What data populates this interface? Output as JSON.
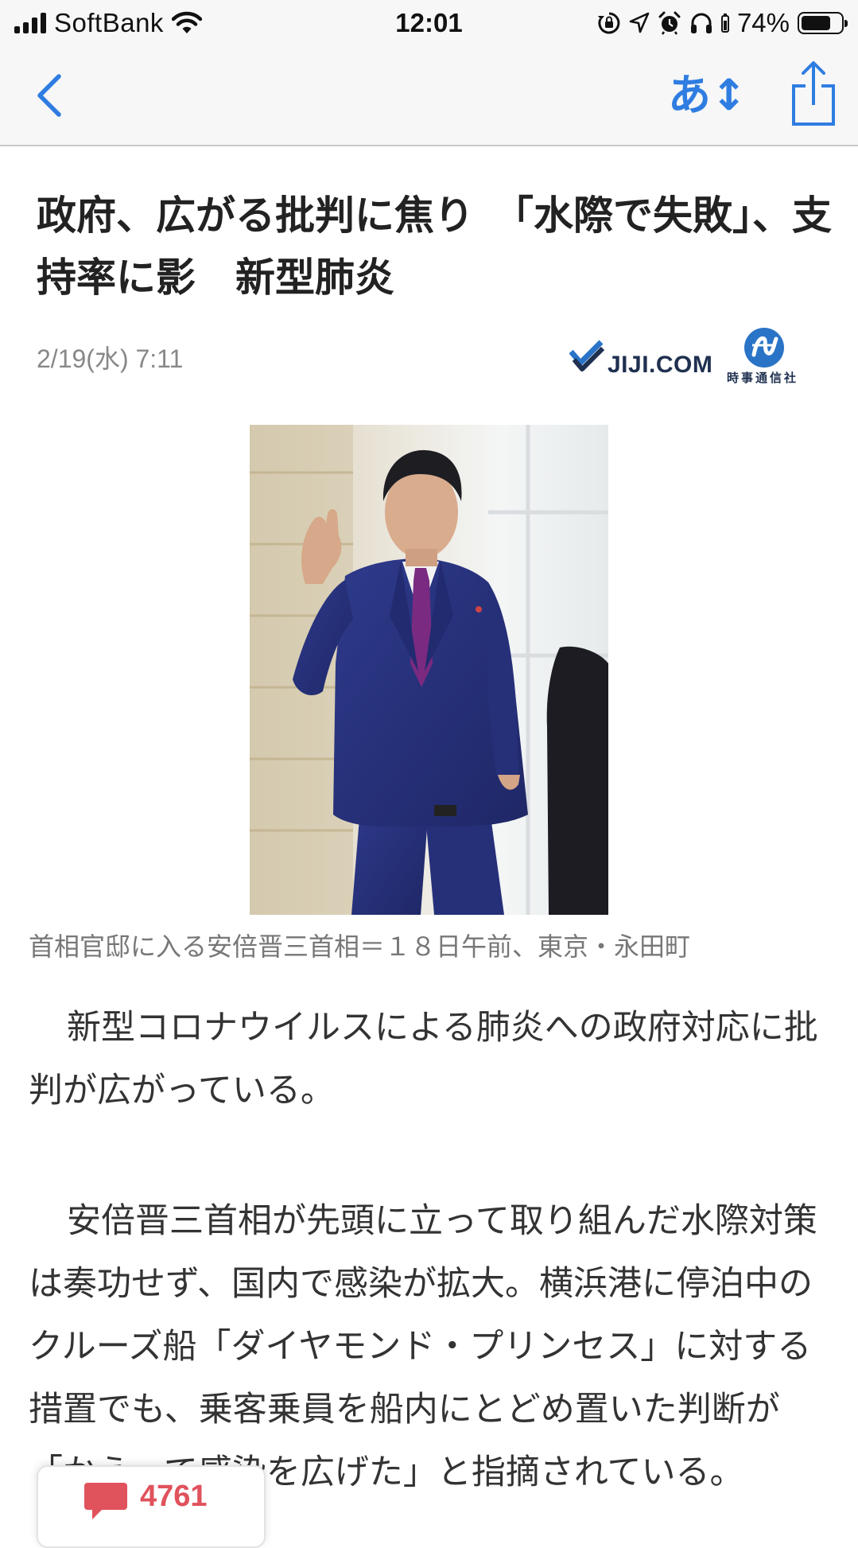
{
  "status_bar": {
    "carrier": "SoftBank",
    "time": "12:01",
    "battery_percent": "74%",
    "battery_level": 0.74,
    "icons": [
      "signal-icon",
      "wifi-icon",
      "rotation-lock-icon",
      "location-icon",
      "alarm-icon",
      "headphones-icon",
      "battery-icon"
    ]
  },
  "nav": {
    "back_icon": "chevron-left-icon",
    "text_size_label": "あ↕",
    "share_icon": "share-icon",
    "accent_color": "#2f7de1"
  },
  "article": {
    "headline": "政府、広がる批判に焦り　「水際で失敗」、支持率に影　新型肺炎",
    "date": "2/19(水) 7:11",
    "publisher": {
      "logo_text": "JIJI.COM",
      "logo_subtext": "時事通信社"
    },
    "photo_caption": "首相官邸に入る安倍晋三首相＝１８日午前、東京・永田町",
    "paragraphs": [
      "新型コロナウイルスによる肺炎への政府対応に批判が広がっている。",
      "安倍晋三首相が先頭に立って取り組んだ水際対策は奏功せず、国内で感染が拡大。横浜港に停泊中のクルーズ船「ダイヤモンド・プリンセス」に対する措置でも、乗客乗員を船内にとどめ置いた判断が「かえって感染を広げた」と指摘されている。"
    ]
  },
  "comments": {
    "count": "4761",
    "count_color": "#e0525c"
  }
}
